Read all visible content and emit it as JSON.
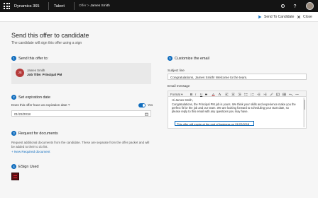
{
  "topbar": {
    "app": "Dynamics 365",
    "module": "Talent",
    "crumb_prefix": "Offer",
    "crumb_name": "James Smith"
  },
  "commands": {
    "send": "Send To Candidate",
    "close": "Close"
  },
  "page": {
    "title": "Send this offer to candidate",
    "subtitle": "The candidate will sign this offer using a sign"
  },
  "send_to": {
    "number": "1",
    "title": "Send this offer to:",
    "initials": "JS",
    "name": "James Smith",
    "job_title": "Job Title: Principal PM"
  },
  "expiration": {
    "number": "2",
    "title": "Set expiration date",
    "question": "Does this offer have an expiration date ?",
    "toggle_label": "Yes",
    "toggle_on": true,
    "date": "01/22/2018"
  },
  "documents": {
    "number": "3",
    "title": "Request for documents",
    "description": "Request additional documents from the candidate. These are separate from the offer packet and will be added to their to do list.",
    "link": "+ New Required document"
  },
  "esign": {
    "number": "4",
    "title": "ESign Used"
  },
  "email": {
    "number": "5",
    "title": "Customize the email",
    "subject_label": "Subject line",
    "subject_value": "Congratulations, James Smith! Welcome to the team.",
    "message_label": "Email message",
    "toolbar": {
      "format": "Format",
      "bold": "B",
      "italic": "I",
      "underline": "U",
      "strike": "S"
    },
    "body_greeting": "Hi James Smith,",
    "body_text": "Congratulations, the Principal PM job is yours. We think your skills and experience make you the perfect fit for the job and our team. We are looking forward to scheduling your start date, so please reply to this email with any questions you may have.",
    "expiry_notice": "This offer will expire at the end of business on 01/22/2018"
  },
  "colors": {
    "accent": "#0f6cbd",
    "topbar": "#141414"
  }
}
